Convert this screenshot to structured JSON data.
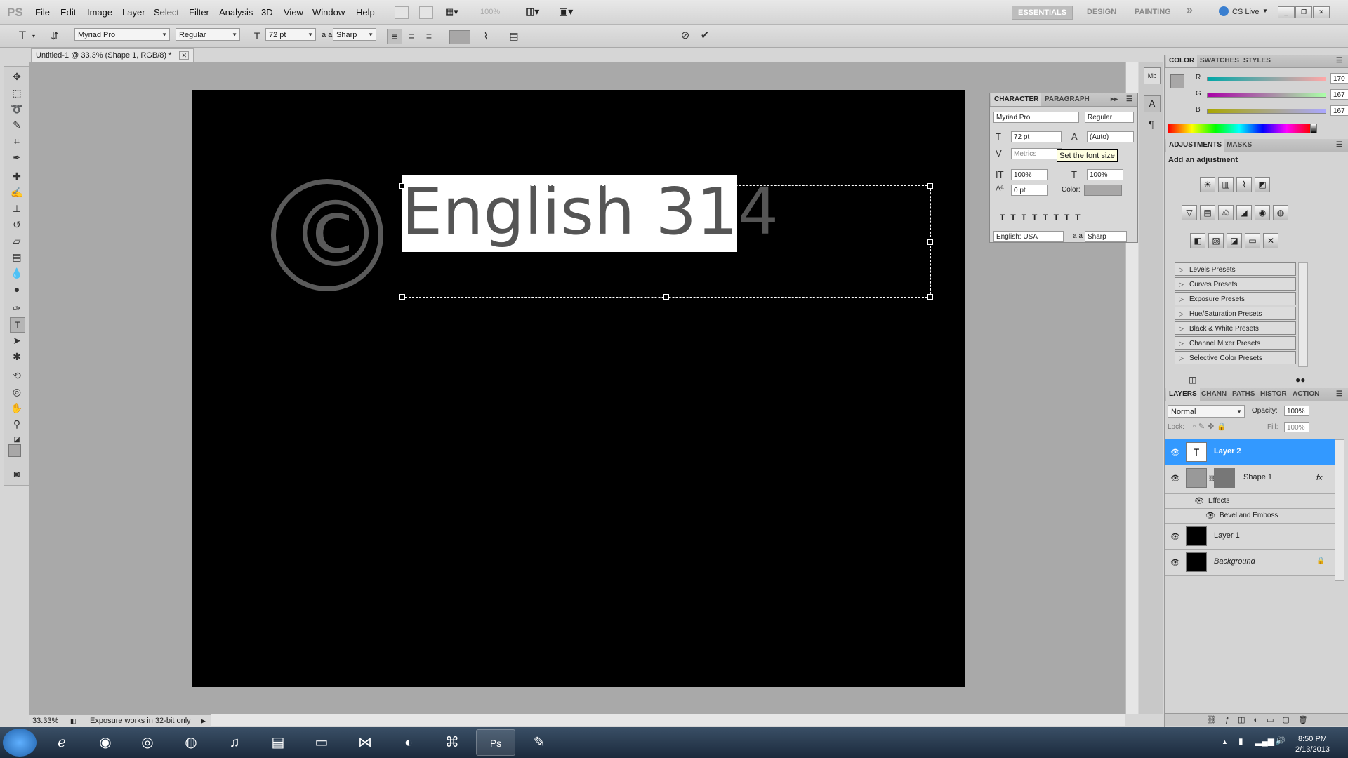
{
  "app": {
    "logo": "PS",
    "menu": [
      "File",
      "Edit",
      "Image",
      "Layer",
      "Select",
      "Filter",
      "Analysis",
      "3D",
      "View",
      "Window",
      "Help"
    ],
    "zoom_select": "100%",
    "workspaces": [
      "ESSENTIALS",
      "DESIGN",
      "PAINTING"
    ],
    "more": "»",
    "cs_live": "CS Live"
  },
  "options_bar": {
    "font_family": "Myriad Pro",
    "font_style": "Regular",
    "font_size": "72 pt",
    "antialias_prefix": "a a",
    "antialias": "Sharp"
  },
  "document": {
    "tab_title": "Untitled-1 @ 33.3% (Shape 1, RGB/8) *",
    "headline": "English 314",
    "copyright_symbol": "©",
    "zoom": "33.33%",
    "status": "Exposure works in 32-bit only"
  },
  "color_panel": {
    "tabs": [
      "COLOR",
      "SWATCHES",
      "STYLES"
    ],
    "channels": [
      {
        "label": "R",
        "value": "170"
      },
      {
        "label": "G",
        "value": "167"
      },
      {
        "label": "B",
        "value": "167"
      }
    ]
  },
  "adjustments_panel": {
    "tabs": [
      "ADJUSTMENTS",
      "MASKS"
    ],
    "heading": "Add an adjustment",
    "presets": [
      "Levels Presets",
      "Curves Presets",
      "Exposure Presets",
      "Hue/Saturation Presets",
      "Black & White Presets",
      "Channel Mixer Presets",
      "Selective Color Presets"
    ]
  },
  "layers_panel": {
    "tabs": [
      "LAYERS",
      "CHANN",
      "PATHS",
      "HISTOR",
      "ACTION"
    ],
    "blend_mode": "Normal",
    "opacity_label": "Opacity:",
    "opacity": "100%",
    "lock_label": "Lock:",
    "fill_label": "Fill:",
    "fill": "100%",
    "layers": [
      {
        "name": "Layer 2",
        "selected": true
      },
      {
        "name": "Shape 1",
        "selected": false
      },
      {
        "name": "Layer 1",
        "selected": false
      },
      {
        "name": "Background",
        "selected": false
      }
    ],
    "effects_label": "Effects",
    "effect": "Bevel and Emboss",
    "fx": "fx"
  },
  "character_panel": {
    "tabs": [
      "CHARACTER",
      "PARAGRAPH"
    ],
    "font_family": "Myriad Pro",
    "font_style": "Regular",
    "size": "72 pt",
    "leading": "(Auto)",
    "kerning": "Metrics",
    "vscale": "100%",
    "hscale": "100%",
    "baseline": "0 pt",
    "color_label": "Color:",
    "language": "English: USA",
    "antialias_prefix": "a a",
    "antialias": "Sharp",
    "tooltip": "Set the font size"
  },
  "taskbar": {
    "time": "8:50 PM",
    "date": "2/13/2013",
    "ps_label": "Ps"
  }
}
